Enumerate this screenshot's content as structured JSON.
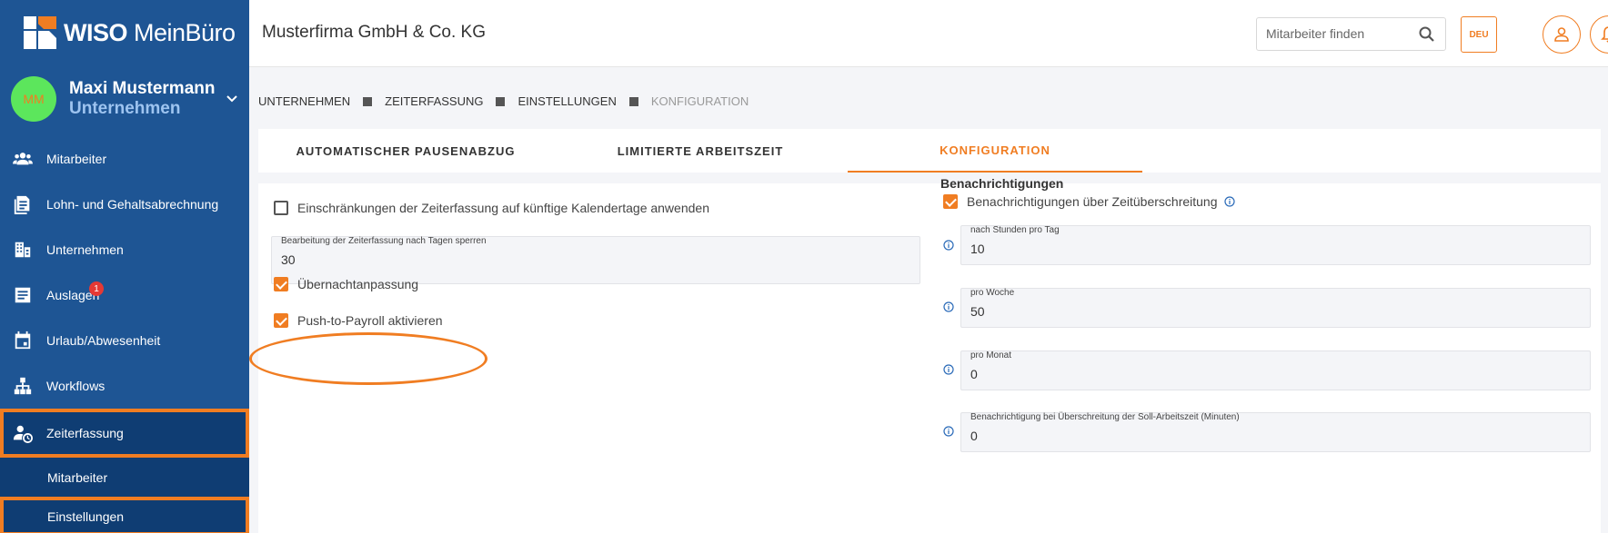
{
  "brand": {
    "logo_bold": "WISO",
    "logo_light": " MeinBüro",
    "accent": "#f07d22",
    "sidebar_bg": "#1e5594"
  },
  "user": {
    "initials": "MM",
    "name": "Maxi Mustermann",
    "role": "Unternehmen"
  },
  "sidebar": {
    "items": [
      {
        "label": "Mitarbeiter",
        "icon": "people-icon"
      },
      {
        "label": "Lohn- und Gehaltsabrechnung",
        "icon": "payroll-icon"
      },
      {
        "label": "Unternehmen",
        "icon": "building-icon"
      },
      {
        "label": "Auslagen",
        "icon": "receipt-icon",
        "badge": "1"
      },
      {
        "label": "Urlaub/Abwesenheit",
        "icon": "calendar-icon"
      },
      {
        "label": "Workflows",
        "icon": "workflow-icon"
      },
      {
        "label": "Zeiterfassung",
        "icon": "user-clock-icon"
      }
    ],
    "sub_items": [
      {
        "label": "Mitarbeiter"
      },
      {
        "label": "Einstellungen"
      }
    ]
  },
  "topbar": {
    "company": "Musterfirma GmbH & Co. KG",
    "search_placeholder": "Mitarbeiter finden",
    "lang": "DEU"
  },
  "breadcrumb": [
    "UNTERNEHMEN",
    "ZEITERFASSUNG",
    "EINSTELLUNGEN",
    "KONFIGURATION"
  ],
  "tabs": [
    {
      "label": "AUTOMATISCHER PAUSENABZUG"
    },
    {
      "label": "LIMITIERTE ARBEITSZEIT"
    },
    {
      "label": "KONFIGURATION"
    }
  ],
  "left": {
    "restrict_future_label": "Einschränkungen der Zeiterfassung auf künftige Kalendertage anwenden",
    "restrict_future_checked": false,
    "lock_label": "Bearbeitung der Zeiterfassung nach Tagen sperren",
    "lock_value": "30",
    "overnight_label": "Übernachtanpassung",
    "overnight_checked": true,
    "push_label": "Push-to-Payroll aktivieren",
    "push_checked": true
  },
  "right": {
    "section_title": "Benachrichtigungen",
    "overtime_label": "Benachrichtigungen über Zeitüberschreitung",
    "overtime_checked": true,
    "fields": [
      {
        "label": "nach Stunden pro Tag",
        "value": "10"
      },
      {
        "label": "pro Woche",
        "value": "50"
      },
      {
        "label": "pro Monat",
        "value": "0"
      },
      {
        "label": "Benachrichtigung bei Überschreitung der Soll-Arbeitszeit (Minuten)",
        "value": "0"
      }
    ]
  }
}
